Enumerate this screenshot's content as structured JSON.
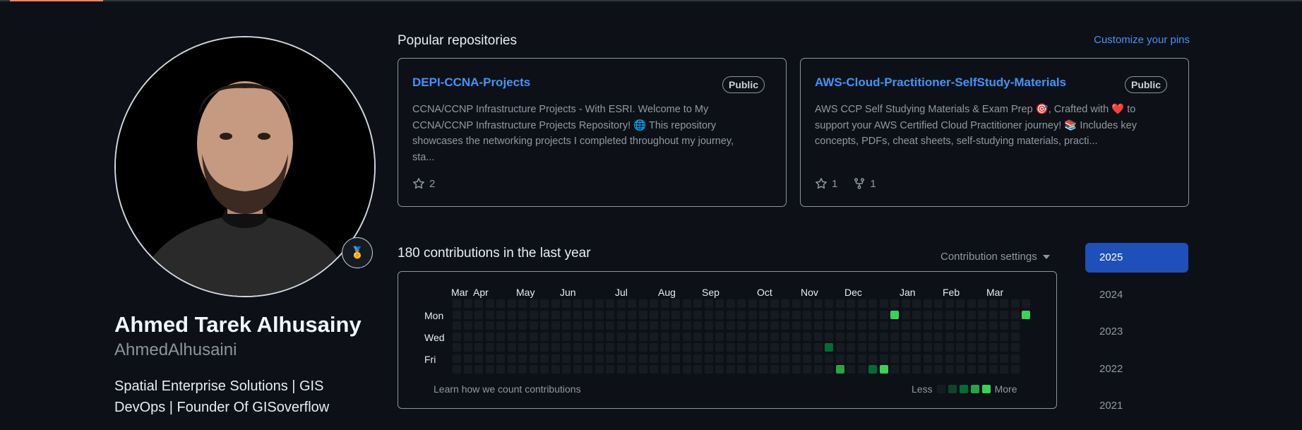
{
  "profile": {
    "full_name": "Ahmed Tarek Alhusainy",
    "username": "AhmedAlhusaini",
    "bio": "Spatial Enterprise Solutions | GIS DevOps | Founder Of GISoverflow",
    "achievement_icon": "medal-icon"
  },
  "popular": {
    "title": "Popular repositories",
    "customize_label": "Customize your pins",
    "repos": [
      {
        "name": "DEPI-CCNA-Projects",
        "visibility": "Public",
        "description": "CCNA/CCNP Infrastructure Projects - With ESRI. Welcome to My CCNA/CCNP Infrastructure Projects Repository! 🌐 This repository showcases the networking projects I completed throughout my journey, sta...",
        "stars": "2",
        "forks": ""
      },
      {
        "name": "AWS-Cloud-Practitioner-SelfStudy-Materials",
        "visibility": "Public",
        "description": "AWS CCP Self Studying Materials & Exam Prep 🎯, Crafted with ❤️ to support your AWS Certified Cloud Practitioner journey! 📚 Includes key concepts, PDFs, cheat sheets, self-studying materials, practi...",
        "stars": "1",
        "forks": "1"
      }
    ]
  },
  "contributions": {
    "title": "180 contributions in the last year",
    "settings_label": "Contribution settings",
    "months": [
      "Mar",
      "Apr",
      "May",
      "Jun",
      "Jul",
      "Aug",
      "Sep",
      "Oct",
      "Nov",
      "Dec",
      "Jan",
      "Feb",
      "Mar"
    ],
    "day_labels": [
      "Mon",
      "Wed",
      "Fri"
    ],
    "learn_label": "Learn how we count contributions",
    "legend_less": "Less",
    "legend_more": "More",
    "level_colors": [
      "#161b22",
      "#0e4429",
      "#006d32",
      "#26a641",
      "#39d353"
    ],
    "weeks": 53,
    "highlighted_cells": [
      {
        "week": 40,
        "day": 1,
        "level": 4
      },
      {
        "week": 52,
        "day": 1,
        "level": 4
      },
      {
        "week": 34,
        "day": 4,
        "level": 2
      },
      {
        "week": 35,
        "day": 6,
        "level": 3
      },
      {
        "week": 38,
        "day": 6,
        "level": 2
      },
      {
        "week": 39,
        "day": 6,
        "level": 4
      },
      {
        "week": 38,
        "day": 7,
        "level": 2
      },
      {
        "week": 48,
        "day": 7,
        "level": 4
      }
    ]
  },
  "years": [
    "2025",
    "2024",
    "2023",
    "2022",
    "2021"
  ],
  "active_year": "2025"
}
